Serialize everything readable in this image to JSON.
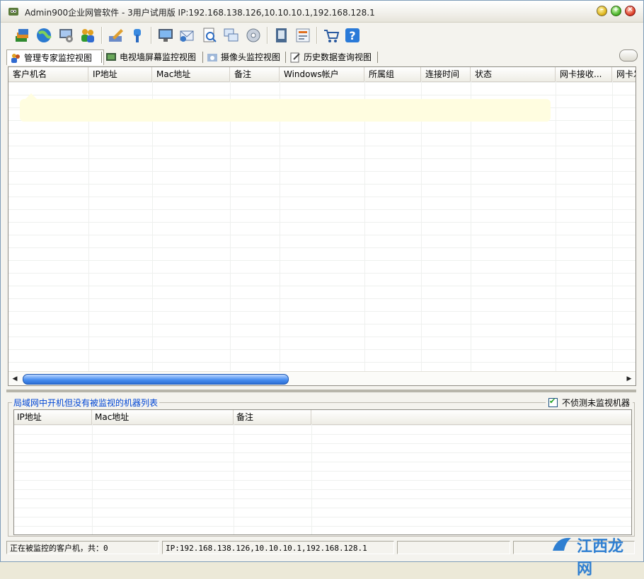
{
  "window": {
    "title": "Admin900企业网管软件 - 3用户试用版 IP:192.168.138.126,10.10.10.1,192.168.128.1"
  },
  "toolbar": {
    "buttons": [
      "stack-icon",
      "globe-icon",
      "screen-gear-icon",
      "users-icon",
      "pencil-icon",
      "hand-icon",
      "monitor-icon",
      "mail-icon",
      "document-search-icon",
      "windows-icon",
      "disc-icon",
      "book-icon",
      "form-icon",
      "cart-icon",
      "help-icon"
    ]
  },
  "tabs": [
    {
      "label": "管理专家监控视图",
      "active": true
    },
    {
      "label": "电视墙屏幕监控视图",
      "active": false
    },
    {
      "label": "摄像头监控视图",
      "active": false
    },
    {
      "label": "历史数据查询视图",
      "active": false
    }
  ],
  "main_grid": {
    "columns": [
      "客户机名",
      "IP地址",
      "Mac地址",
      "备注",
      "Windows帐户",
      "所属组",
      "连接时间",
      "状态",
      "网卡接收...",
      "网卡发"
    ],
    "rows": []
  },
  "lower_panel": {
    "title": "局域网中开机但没有被监视的机器列表",
    "checkbox_label": "不侦测未监视机器",
    "checkbox_checked": true,
    "columns": [
      "IP地址",
      "Mac地址",
      "备注"
    ]
  },
  "statusbar": {
    "monitored": "正在被监控的客户机，共：0",
    "ip": "IP:192.168.138.126,10.10.10.1,192.168.128.1"
  },
  "watermark": {
    "text": "江西龙网"
  }
}
